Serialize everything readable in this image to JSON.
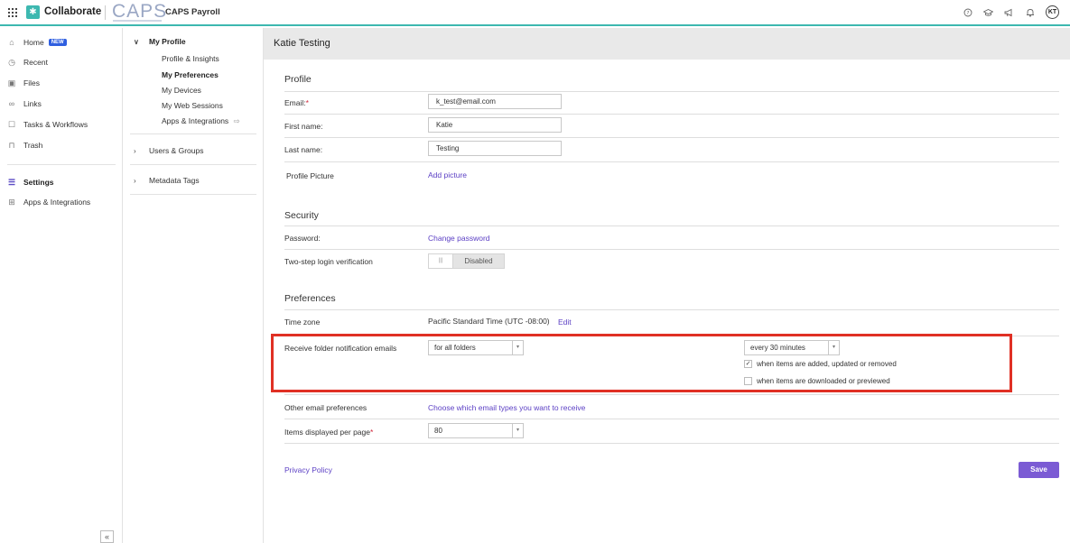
{
  "topbar": {
    "app_name": "Collaborate",
    "brand_logo_text": "CAPS",
    "brand_name": "CAPS Payroll",
    "avatar_initials": "KT",
    "icons": [
      "help-icon",
      "graduation-cap-icon",
      "megaphone-icon",
      "bell-icon"
    ]
  },
  "leftnav": {
    "items": [
      {
        "label": "Home",
        "icon": "home-icon",
        "badge": "NEW"
      },
      {
        "label": "Recent",
        "icon": "clock-icon"
      },
      {
        "label": "Files",
        "icon": "files-icon"
      },
      {
        "label": "Links",
        "icon": "link-icon"
      },
      {
        "label": "Tasks & Workflows",
        "icon": "clipboard-icon"
      },
      {
        "label": "Trash",
        "icon": "trash-icon"
      }
    ],
    "settings_label": "Settings",
    "apps_label": "Apps & Integrations",
    "collapse_glyph": "«"
  },
  "subnav": {
    "my_profile": "My Profile",
    "profile_items": [
      "Profile & Insights",
      "My Preferences",
      "My Devices",
      "My Web Sessions",
      "Apps & Integrations"
    ],
    "users_groups": "Users & Groups",
    "metadata_tags": "Metadata Tags"
  },
  "main": {
    "title": "Katie Testing",
    "profile": {
      "section": "Profile",
      "email_label": "Email:",
      "email_value": "k_test@email.com",
      "first_label": "First name:",
      "first_value": "Katie",
      "last_label": "Last name:",
      "last_value": "Testing",
      "picture_label": "Profile Picture",
      "picture_link": "Add picture"
    },
    "security": {
      "section": "Security",
      "password_label": "Password:",
      "password_link": "Change password",
      "twostep_label": "Two-step login verification",
      "twostep_state": "Disabled"
    },
    "preferences": {
      "section": "Preferences",
      "timezone_label": "Time zone",
      "timezone_value": "Pacific Standard Time (UTC -08:00)",
      "timezone_edit": "Edit",
      "folder_notif_label": "Receive folder notification emails",
      "folder_scope": "for all folders",
      "frequency": "every 30 minutes",
      "opt_added": "when items are added, updated or removed",
      "opt_added_checked": true,
      "opt_downloaded": "when items are downloaded or previewed",
      "opt_downloaded_checked": false,
      "other_label": "Other email preferences",
      "other_link": "Choose which email types you want to receive",
      "per_page_label": "Items displayed per page",
      "per_page_value": "80"
    },
    "privacy_link": "Privacy Policy",
    "save_label": "Save"
  },
  "colors": {
    "accent_teal": "#3db8b0",
    "link_purple": "#5b3fc4",
    "save_purple": "#7b5bd4",
    "highlight_red": "#e03024"
  }
}
